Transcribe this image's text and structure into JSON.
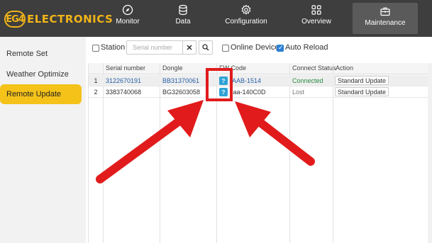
{
  "brand": {
    "logo_mark": "EG4",
    "logo_text": "ELECTRONICS",
    "accent": "#f1b418"
  },
  "nav": {
    "items": [
      {
        "label": "Monitor",
        "icon": "compass-icon"
      },
      {
        "label": "Data",
        "icon": "database-icon"
      },
      {
        "label": "Configuration",
        "icon": "gear-icon"
      },
      {
        "label": "Overview",
        "icon": "grid-icon"
      },
      {
        "label": "Maintenance",
        "icon": "toolbox-icon",
        "active": true
      }
    ]
  },
  "sidebar": {
    "items": [
      {
        "label": "Remote Set"
      },
      {
        "label": "Weather Optimize"
      },
      {
        "label": "Remote Update",
        "active": true
      }
    ]
  },
  "filters": {
    "station_label": "Station",
    "serial_placeholder": "Serial number",
    "online_label": "Online Device",
    "auto_reload_label": "Auto Reload",
    "auto_reload_checked": true
  },
  "table": {
    "headers": {
      "serial": "Serial number",
      "dongle": "Dongle",
      "fw": "FW Code",
      "status": "Connect Status",
      "action": "Action"
    },
    "rows": [
      {
        "num": "1",
        "serial": "3122670191",
        "dongle": "BB31370061",
        "fw": "-AAB-1514",
        "status": "Connected",
        "action": "Standard Update"
      },
      {
        "num": "2",
        "serial": "3383740068",
        "dongle": "BG32603058",
        "fw": "caa-140C0D",
        "status": "Lost",
        "action": "Standard Update"
      }
    ]
  },
  "fw_help_glyph": "?",
  "colors": {
    "topbar": "#3e3e3e",
    "sidebar_active": "#f4c219",
    "highlight": "#e11b1b",
    "connected": "#2b8a3e",
    "link": "#2861a8"
  }
}
